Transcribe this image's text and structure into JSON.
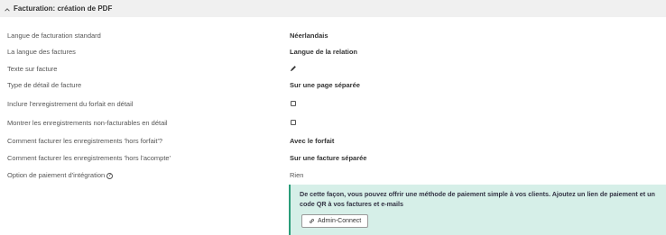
{
  "section": {
    "title": "Facturation: création de PDF",
    "collapse_icon": "chevron-up-icon"
  },
  "rows": [
    {
      "label": "Langue de facturation standard",
      "value": "Néerlandais",
      "type": "text-bold"
    },
    {
      "label": "La langue des factures",
      "value": "Langue de la relation",
      "type": "text-bold"
    },
    {
      "label": "Texte sur facture",
      "value": "",
      "type": "pencil",
      "icon": "pencil-icon"
    },
    {
      "label": "Type de détail de facture",
      "value": "Sur une page séparée",
      "type": "text-bold"
    },
    {
      "label": "Inclure l'enregistrement du forfait en détail",
      "value": "",
      "type": "checkbox",
      "checked": false
    },
    {
      "label": "Montrer les enregistrements non-facturables en détail",
      "value": "",
      "type": "checkbox",
      "checked": false
    },
    {
      "label": "Comment facturer les enregistrements 'hors forfait'?",
      "value": "Avec le forfait",
      "type": "text-bold"
    },
    {
      "label": "Comment facturer les enregistrements 'hors l'acompte'",
      "value": "Sur une facture séparée",
      "type": "text-bold"
    },
    {
      "label": "Option de paiement d'intégration",
      "value": "Rien",
      "type": "text-regular",
      "help_icon": "help-circle-icon",
      "help_glyph": "?"
    }
  ],
  "info": {
    "text": "De cette façon, vous pouvez offrir une méthode de paiement simple à vos clients. Ajoutez un lien de paiement et un code QR à vos factures et e-mails",
    "button_label": "Admin-Connect",
    "button_icon": "link-icon",
    "accent": "#2a9d79",
    "background": "#d6efe8"
  }
}
